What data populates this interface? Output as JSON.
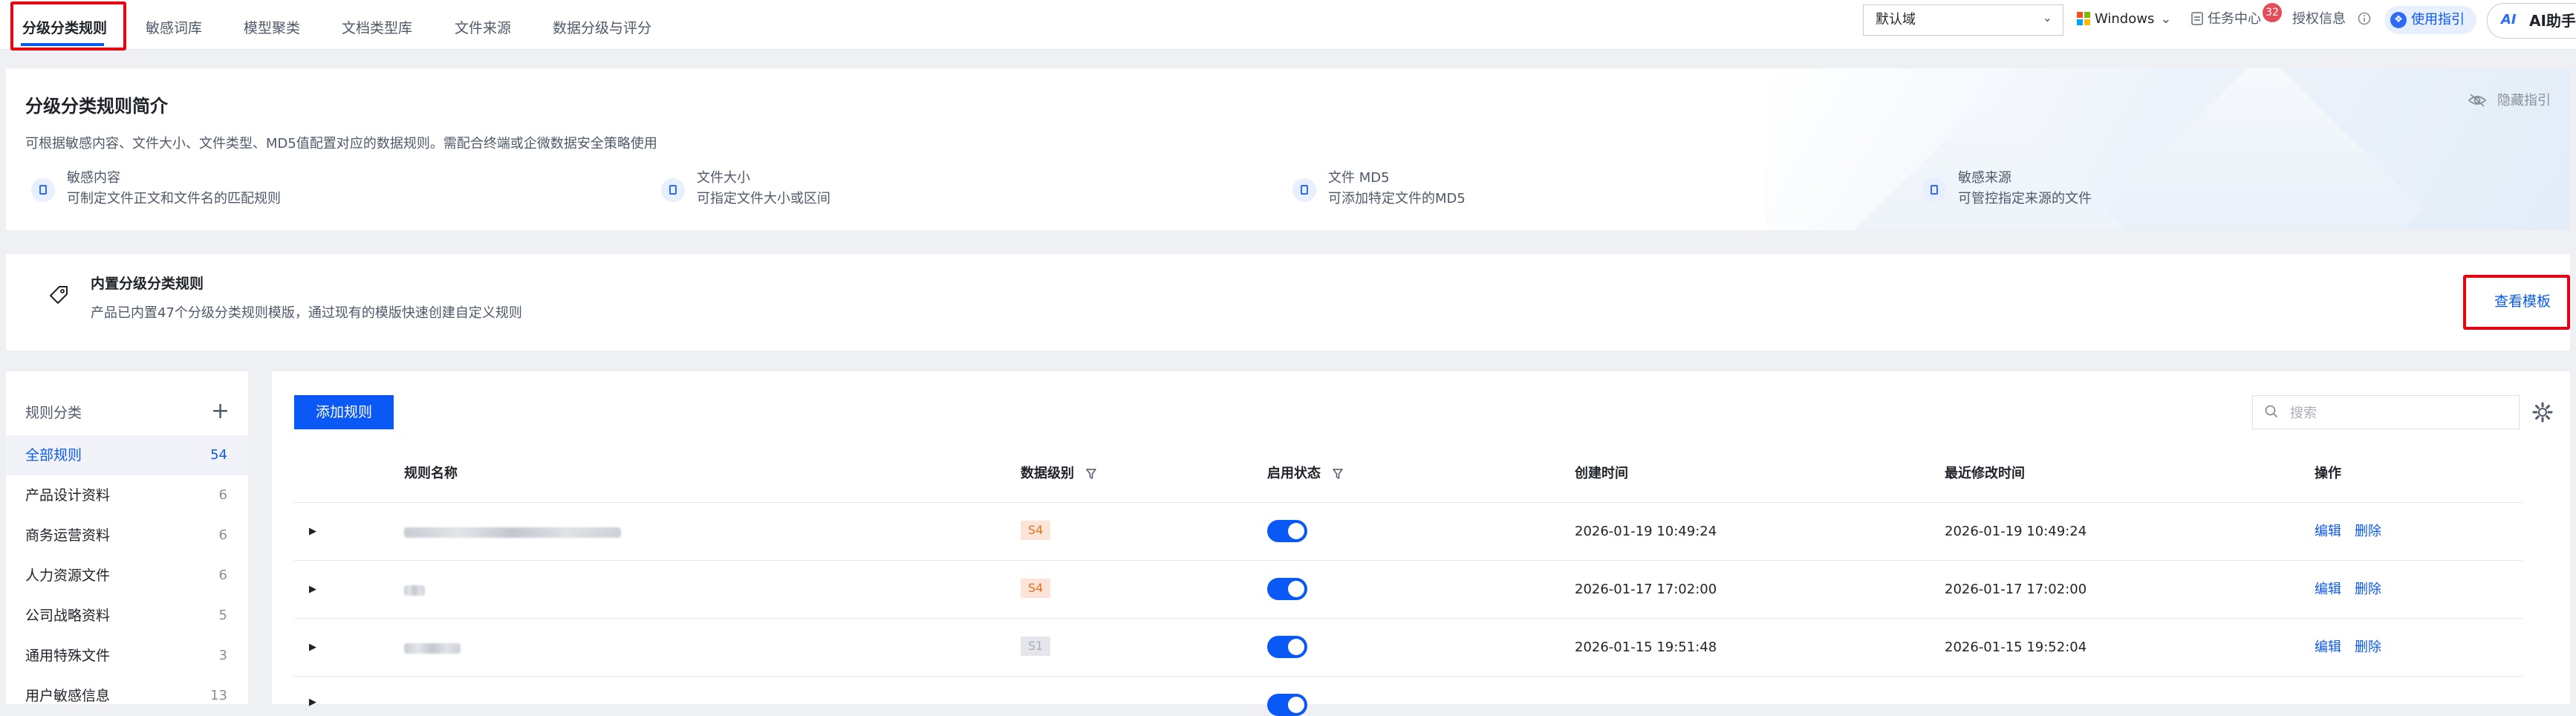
{
  "nav": {
    "tabs": [
      "分级分类规则",
      "敏感词库",
      "模型聚类",
      "文档类型库",
      "文件来源",
      "数据分级与评分"
    ],
    "domain_select": "默认域",
    "os_select": "Windows",
    "task_center": "任务中心",
    "task_badge": "32",
    "license": "授权信息",
    "guide": "使用指引",
    "ai_assistant": "AI助手"
  },
  "intro": {
    "title": "分级分类规则简介",
    "description": "可根据敏感内容、文件大小、文件类型、MD5值配置对应的数据规则。需配合终端或企微数据安全策略使用",
    "hide_guide": "隐藏指引",
    "features": [
      {
        "title": "敏感内容",
        "desc": "可制定文件正文和文件名的匹配规则",
        "icon": "document-icon"
      },
      {
        "title": "文件大小",
        "desc": "可指定文件大小或区间",
        "icon": "file-size-icon"
      },
      {
        "title": "文件 MD5",
        "desc": "可添加特定文件的MD5",
        "icon": "md5-icon"
      },
      {
        "title": "敏感来源",
        "desc": "可管控指定来源的文件",
        "icon": "source-icon"
      }
    ]
  },
  "builtin": {
    "title": "内置分级分类规则",
    "description": "产品已内置47个分级分类规则模版，通过现有的模版快速创建自定义规则",
    "view_template": "查看模板"
  },
  "sidebar": {
    "header": "规则分类",
    "items": [
      {
        "label": "全部规则",
        "count": "54"
      },
      {
        "label": "产品设计资料",
        "count": "6"
      },
      {
        "label": "商务运营资料",
        "count": "6"
      },
      {
        "label": "人力资源文件",
        "count": "6"
      },
      {
        "label": "公司战略资料",
        "count": "5"
      },
      {
        "label": "通用特殊文件",
        "count": "3"
      },
      {
        "label": "用户敏感信息",
        "count": "13"
      }
    ]
  },
  "table": {
    "add_button": "添加规则",
    "search_placeholder": "搜索",
    "columns": [
      "规则名称",
      "数据级别",
      "启用状态",
      "创建时间",
      "最近修改时间",
      "操作"
    ],
    "rows": [
      {
        "level": "S4",
        "enabled": true,
        "created": "2026-01-19 10:49:24",
        "modified": "2026-01-19 10:49:24"
      },
      {
        "level": "S4",
        "enabled": true,
        "created": "2026-01-17 17:02:00",
        "modified": "2026-01-17 17:02:00"
      },
      {
        "level": "S1",
        "enabled": true,
        "created": "2026-01-15 19:51:48",
        "modified": "2026-01-15 19:52:04"
      }
    ],
    "actions": {
      "edit": "编辑",
      "delete": "删除"
    }
  }
}
